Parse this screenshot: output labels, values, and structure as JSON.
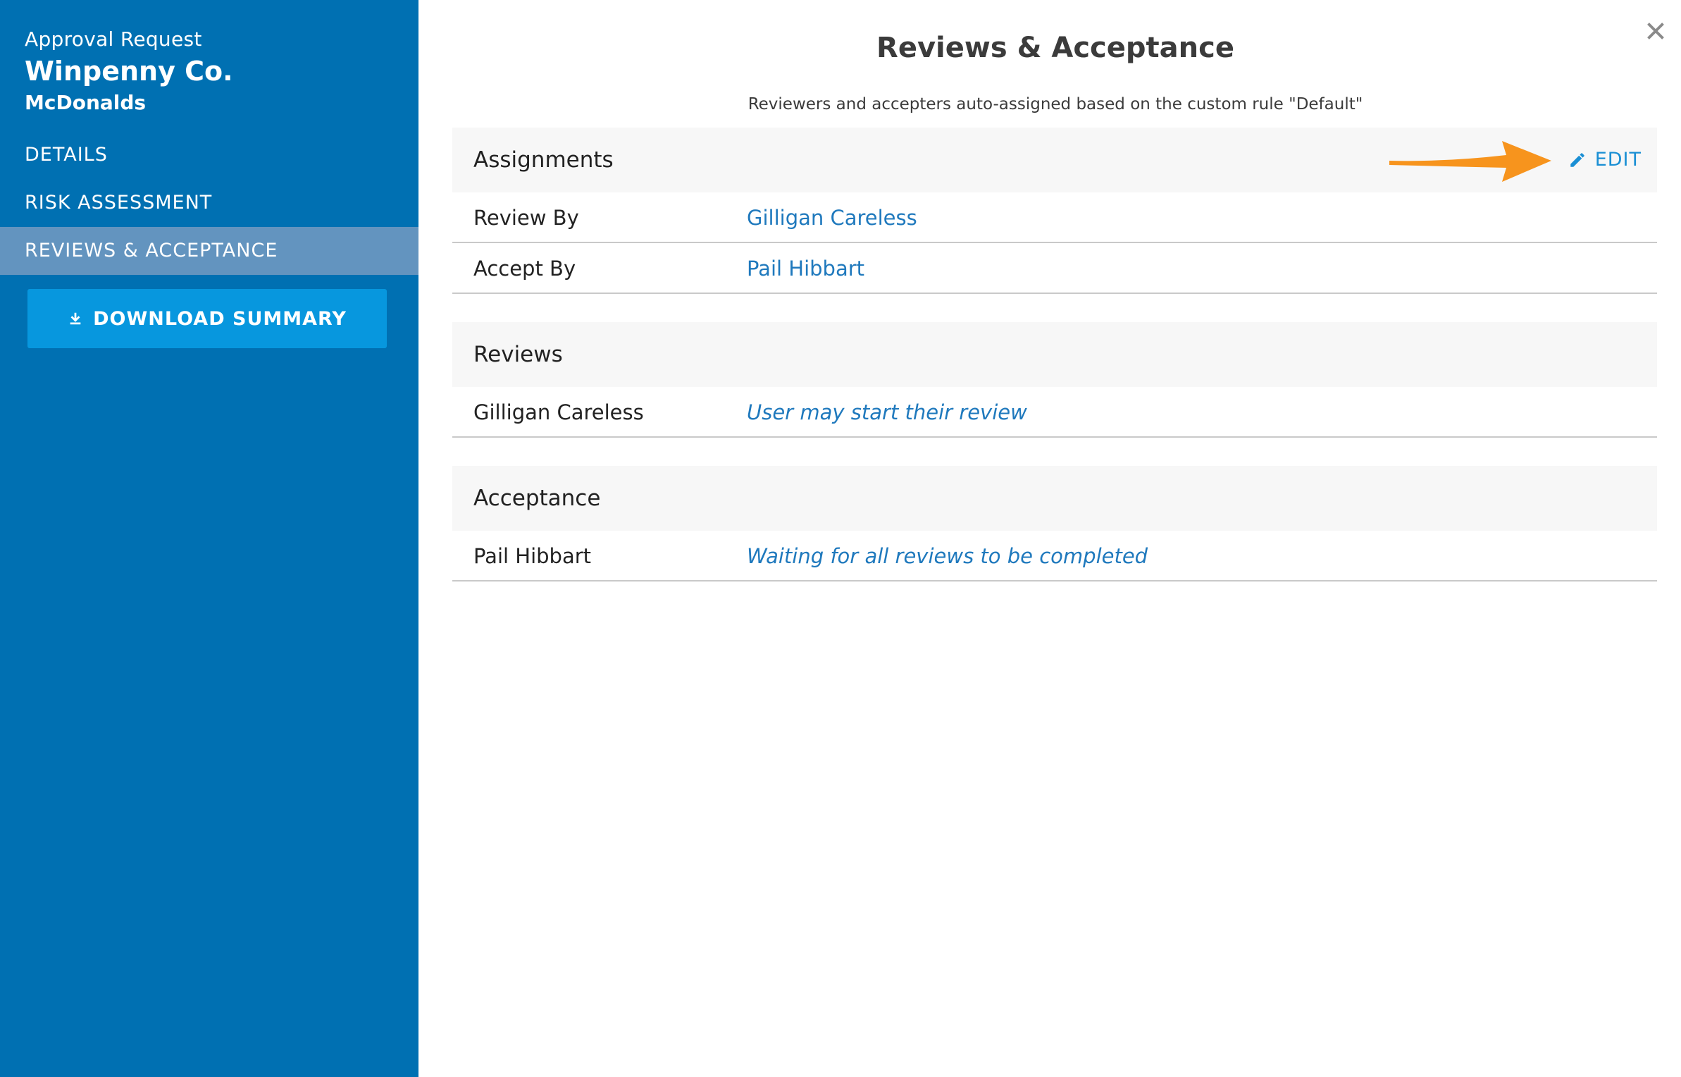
{
  "sidebar": {
    "caption": "Approval Request",
    "title": "Winpenny Co.",
    "subtitle": "McDonalds",
    "nav": [
      {
        "label": "DETAILS"
      },
      {
        "label": "RISK ASSESSMENT"
      },
      {
        "label": "REVIEWS & ACCEPTANCE",
        "active": true
      }
    ],
    "download_label": "DOWNLOAD SUMMARY",
    "download_icon": "download-icon"
  },
  "main": {
    "title": "Reviews & Acceptance",
    "description": "Reviewers and accepters auto-assigned based on the custom rule \"Default\"",
    "close_icon": "close-icon",
    "assignments": {
      "header": "Assignments",
      "edit_label": "EDIT",
      "edit_icon": "pencil-icon",
      "rows": [
        {
          "label": "Review By",
          "value": "Gilligan Careless"
        },
        {
          "label": "Accept By",
          "value": "Pail Hibbart"
        }
      ]
    },
    "reviews": {
      "header": "Reviews",
      "rows": [
        {
          "name": "Gilligan Careless",
          "status": "User may start their review"
        }
      ]
    },
    "acceptance": {
      "header": "Acceptance",
      "rows": [
        {
          "name": "Pail Hibbart",
          "status": "Waiting for all reviews to be completed"
        }
      ]
    }
  },
  "colors": {
    "sidebar_bg": "#0070b2",
    "sidebar_active": "#6394bf",
    "download_button": "#0797de",
    "link": "#1f79bd",
    "annotation_arrow": "#f7941d"
  }
}
